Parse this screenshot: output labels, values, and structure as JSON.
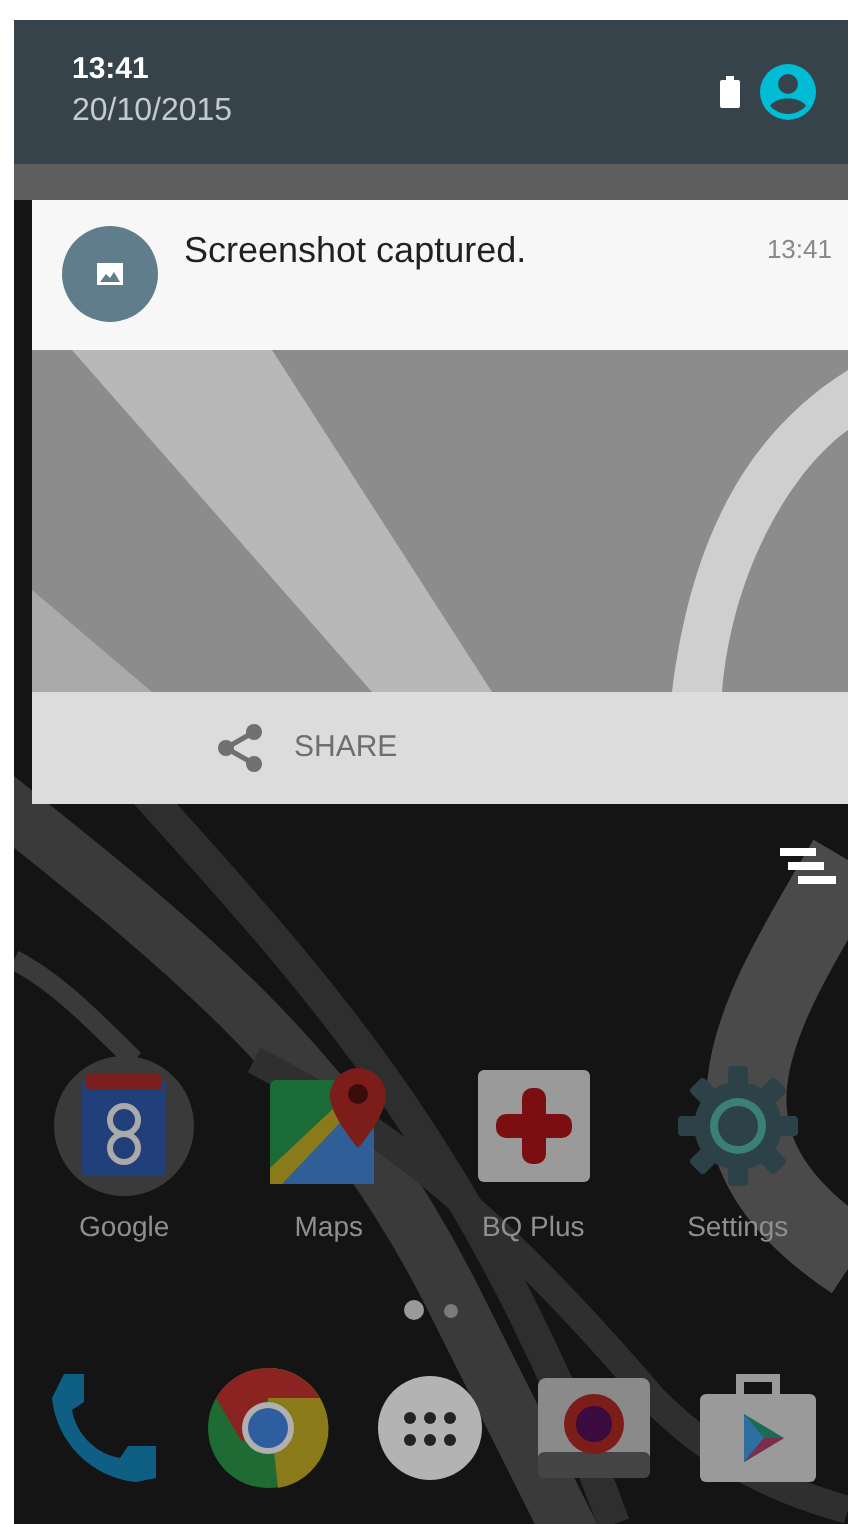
{
  "status_header": {
    "time": "13:41",
    "date": "20/10/2015"
  },
  "notification": {
    "title": "Screenshot captured.",
    "time": "13:41",
    "action": "SHARE"
  },
  "apps": [
    {
      "kind": "google",
      "label": "Google"
    },
    {
      "kind": "maps",
      "label": "Maps"
    },
    {
      "kind": "plus",
      "label": "BQ Plus"
    },
    {
      "kind": "settings",
      "label": "Settings"
    }
  ],
  "page_dots": [
    {
      "selected": true
    },
    {
      "selected": false
    }
  ],
  "dock": [
    {
      "kind": "phone"
    },
    {
      "kind": "chrome"
    },
    {
      "kind": "apps"
    },
    {
      "kind": "camera"
    },
    {
      "kind": "store"
    }
  ]
}
